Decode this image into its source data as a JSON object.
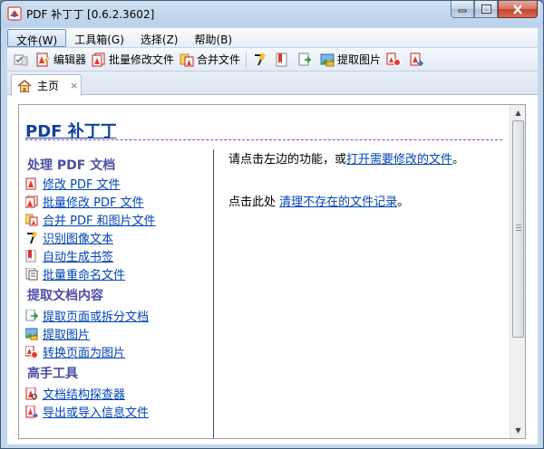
{
  "window": {
    "title": "PDF 补丁丁 [0.6.2.3602]"
  },
  "menubar": {
    "items": [
      "文件(W)",
      "工具箱(G)",
      "选择(Z)",
      "帮助(B)"
    ]
  },
  "toolbar": {
    "editor_label": "编辑器",
    "batch_modify_label": "批量修改文件",
    "merge_label": "合并文件",
    "extract_images_label": "提取图片"
  },
  "tabs": [
    {
      "label": "主页",
      "close": "×"
    }
  ],
  "page": {
    "title": "PDF 补丁丁",
    "sections": [
      {
        "heading": "处理 PDF 文档",
        "links": [
          "修改 PDF 文件",
          "批量修改 PDF 文件",
          "合并 PDF 和图片文件",
          "识别图像文本",
          "自动生成书签",
          "批量重命名文件"
        ]
      },
      {
        "heading": "提取文档内容",
        "links": [
          "提取页面或拆分文档",
          "提取图片",
          "转换页面为图片"
        ]
      },
      {
        "heading": "高手工具",
        "links": [
          "文档结构探查器",
          "导出或导入信息文件"
        ]
      }
    ],
    "right": {
      "line1_prefix": "请点击左边的功能，或",
      "line1_link": "打开需要修改的文件",
      "line1_suffix": "。",
      "line2_prefix": "点击此处 ",
      "line2_link": "清理不存在的文件记录",
      "line2_suffix": "。"
    }
  },
  "colors": {
    "title_blue": "#0f3f9a",
    "link_blue": "#0044b8",
    "heading_purple": "#4c4ea8",
    "divider_purple": "#9a40b6"
  }
}
